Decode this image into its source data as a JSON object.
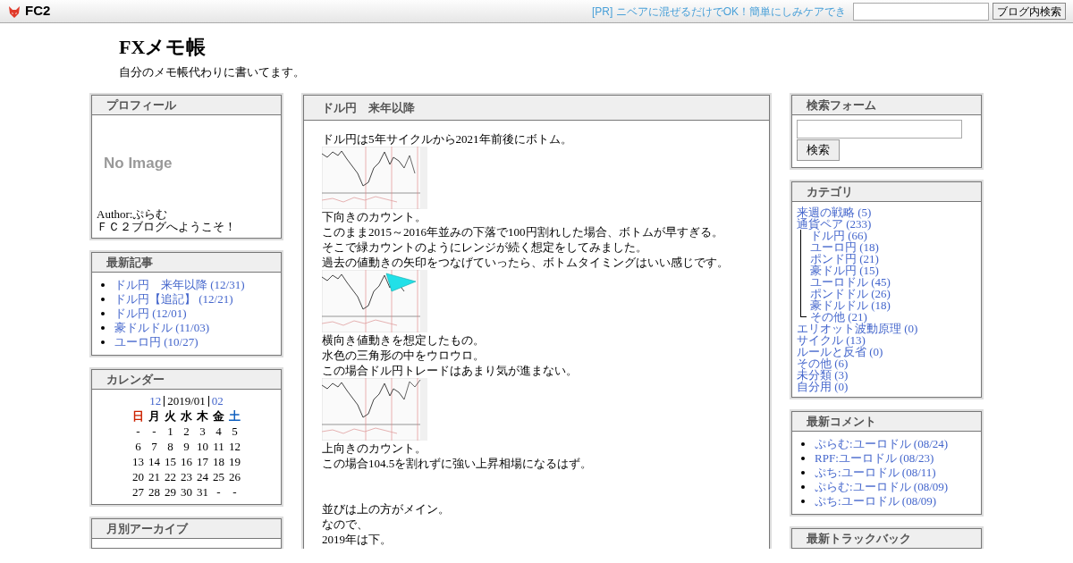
{
  "header_bar": {
    "logo": "FC2",
    "ad_text": "[PR] ニベアに混ぜるだけでOK！簡単にしみケアでき",
    "search_button": "ブログ内検索"
  },
  "blog": {
    "title": "FXメモ帳",
    "description": "自分のメモ帳代わりに書いてます。"
  },
  "left_sidebar": [
    {
      "kind": "profile",
      "title": "プロフィール",
      "no_image_label": "No Image",
      "author": "Author:ぷらむ",
      "greeting": "ＦＣ２ブログへようこそ！"
    },
    {
      "kind": "bullets",
      "title": "最新記事",
      "items": [
        "ドル円　来年以降 (12/31)",
        "ドル円【追記】 (12/21)",
        "ドル円 (12/01)",
        "豪ドルドル (11/03)",
        "ユーロ円 (10/27)"
      ]
    },
    {
      "kind": "calendar",
      "title": "カレンダー",
      "prev": "12",
      "current": "2019/01",
      "next": "02",
      "weekdays": [
        {
          "label": "日",
          "color": "#cc2200"
        },
        {
          "label": "月",
          "color": "#000000"
        },
        {
          "label": "火",
          "color": "#000000"
        },
        {
          "label": "水",
          "color": "#000000"
        },
        {
          "label": "木",
          "color": "#000000"
        },
        {
          "label": "金",
          "color": "#000000"
        },
        {
          "label": "土",
          "color": "#1060c0"
        }
      ],
      "weeks": [
        [
          "-",
          "-",
          "1",
          "2",
          "3",
          "4",
          "5"
        ],
        [
          "6",
          "7",
          "8",
          "9",
          "10",
          "11",
          "12"
        ],
        [
          "13",
          "14",
          "15",
          "16",
          "17",
          "18",
          "19"
        ],
        [
          "20",
          "21",
          "22",
          "23",
          "24",
          "25",
          "26"
        ],
        [
          "27",
          "28",
          "29",
          "30",
          "31",
          "-",
          "-"
        ]
      ]
    },
    {
      "kind": "header_only",
      "title": "月別アーカイブ"
    }
  ],
  "post": {
    "title": "ドル円　来年以降",
    "body": [
      {
        "kind": "text",
        "text": "ドル円は5年サイクルから2021年前後にボトム。"
      },
      {
        "kind": "picture"
      },
      {
        "kind": "text",
        "text": "下向きのカウント。"
      },
      {
        "kind": "text",
        "text": "このまま2015～2016年並みの下落で100円割れした場合、ボトムが早すぎる。"
      },
      {
        "kind": "text",
        "text": "そこで緑カウントのようにレンジが続く想定をしてみました。"
      },
      {
        "kind": "text",
        "text": "過去の値動きの矢印をつなげていったら、ボトムタイミングはいい感じです。"
      },
      {
        "kind": "picture"
      },
      {
        "kind": "text",
        "text": "横向き値動きを想定したもの。"
      },
      {
        "kind": "text",
        "text": "水色の三角形の中をウロウロ。"
      },
      {
        "kind": "text",
        "text": "この場合ドル円トレードはあまり気が進まない。"
      },
      {
        "kind": "picture"
      },
      {
        "kind": "text",
        "text": "上向きのカウント。"
      },
      {
        "kind": "text",
        "text": "この場合104.5を割れずに強い上昇相場になるはず。"
      },
      {
        "kind": "break"
      },
      {
        "kind": "break"
      },
      {
        "kind": "text",
        "text": "並びは上の方がメイン。"
      },
      {
        "kind": "text",
        "text": "なので、"
      },
      {
        "kind": "text",
        "text": "2019年は下。"
      }
    ]
  },
  "right_sidebar": [
    {
      "kind": "search",
      "title": "検索フォーム",
      "button": "検索"
    },
    {
      "kind": "categories",
      "title": "カテゴリ",
      "items": [
        {
          "label": "来週の戦略 (5)"
        },
        {
          "label": "通貨ペア (233)",
          "children": [
            {
              "label": "ドル円 (66)"
            },
            {
              "label": "ユーロ円 (18)"
            },
            {
              "label": "ポンド円 (21)"
            },
            {
              "label": "豪ドル円 (15)"
            },
            {
              "label": "ユーロドル (45)"
            },
            {
              "label": "ポンドドル (26)"
            },
            {
              "label": "豪ドルドル (18)"
            },
            {
              "label": "その他 (21)"
            }
          ]
        },
        {
          "label": "エリオット波動原理 (0)"
        },
        {
          "label": "サイクル (13)"
        },
        {
          "label": "ルールと反省 (0)"
        },
        {
          "label": "その他 (6)"
        },
        {
          "label": "未分類 (3)"
        },
        {
          "label": "自分用 (0)"
        }
      ]
    },
    {
      "kind": "bullets",
      "title": "最新コメント",
      "items": [
        "ぷらむ:ユーロドル (08/24)",
        "RPF:ユーロドル (08/23)",
        "ぷち:ユーロドル (08/11)",
        "ぷらむ:ユーロドル (08/09)",
        "ぷち:ユーロドル (08/09)"
      ]
    },
    {
      "kind": "header_only",
      "title": "最新トラックバック"
    }
  ]
}
